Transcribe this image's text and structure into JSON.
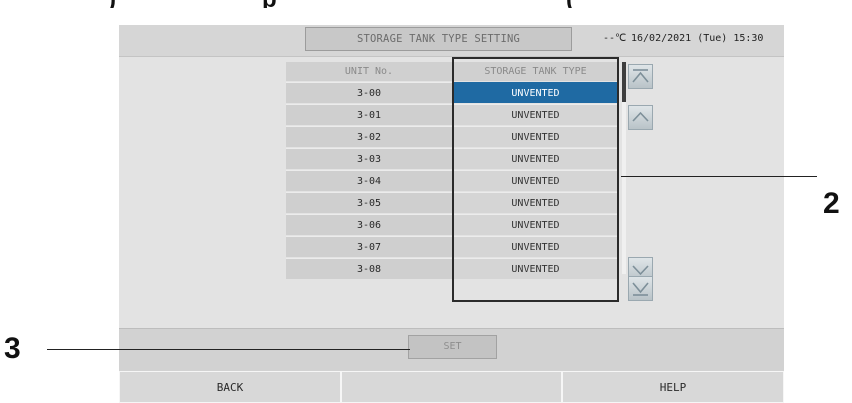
{
  "heading_fragment": {
    "left": ")",
    "middle": "p",
    "right": "("
  },
  "topbar": {
    "title": "STORAGE TANK TYPE SETTING",
    "temperature": "--℃",
    "datetime": "16/02/2021 (Tue) 15:30"
  },
  "table": {
    "headers": {
      "unit": "UNIT No.",
      "type": "STORAGE TANK TYPE"
    },
    "rows": [
      {
        "unit": "3-00",
        "type": "UNVENTED",
        "selected": true
      },
      {
        "unit": "3-01",
        "type": "UNVENTED"
      },
      {
        "unit": "3-02",
        "type": "UNVENTED"
      },
      {
        "unit": "3-03",
        "type": "UNVENTED"
      },
      {
        "unit": "3-04",
        "type": "UNVENTED"
      },
      {
        "unit": "3-05",
        "type": "UNVENTED"
      },
      {
        "unit": "3-06",
        "type": "UNVENTED"
      },
      {
        "unit": "3-07",
        "type": "UNVENTED"
      },
      {
        "unit": "3-08",
        "type": "UNVENTED"
      }
    ]
  },
  "nav_icons": [
    "scroll-to-top-icon",
    "scroll-up-icon",
    "scroll-down-icon",
    "scroll-to-bottom-icon"
  ],
  "set_button": "SET",
  "footer": {
    "back": "BACK",
    "middle": "",
    "help": "HELP"
  },
  "callouts": {
    "type_column": "2",
    "set_button": "3"
  },
  "colors": {
    "selected_row": "#1f6aa3",
    "screen_background": "#e3e3e3"
  }
}
